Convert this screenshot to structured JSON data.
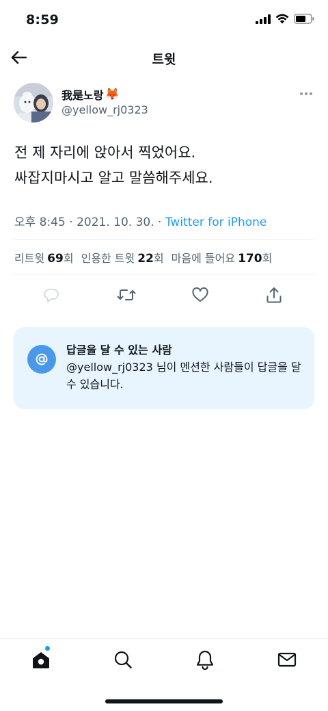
{
  "status_bar": {
    "time": "8:59"
  },
  "header": {
    "title": "트윗"
  },
  "tweet": {
    "author_name": "我是노랑",
    "author_emoji": "🦊",
    "handle": "@yellow_rj0323",
    "text_lines": [
      "전 제 자리에 앉아서 찍었어요.",
      "싸잡지마시고 알고 말씀해주세요."
    ],
    "timestamp": "오후 8:45 · 2021. 10. 30. · ",
    "source": "Twitter for iPhone"
  },
  "stats": {
    "retweets": {
      "label": "리트윗",
      "count": "69",
      "suffix": "회"
    },
    "quotes": {
      "label": "인용한 트윗",
      "count": "22",
      "suffix": "회"
    },
    "likes": {
      "label": "마음에 들어요",
      "count": "170",
      "suffix": "회"
    }
  },
  "icons": {
    "reply": "reply-icon",
    "retweet": "retweet-icon",
    "like": "heart-icon",
    "share": "share-icon",
    "home": "home-icon",
    "search": "search-icon",
    "notifications": "bell-icon",
    "messages": "mail-icon"
  },
  "reply_restriction": {
    "title": "답글을 달 수 있는 사람",
    "description": "@yellow_rj0323 님이 멘션한 사람들이 답글을 달 수 있습니다.",
    "badge_symbol": "@"
  },
  "colors": {
    "accent": "#1d9bf0",
    "card_bg": "#e8f5fe",
    "badge": "#4a99e9",
    "secondary_text": "#536471"
  }
}
